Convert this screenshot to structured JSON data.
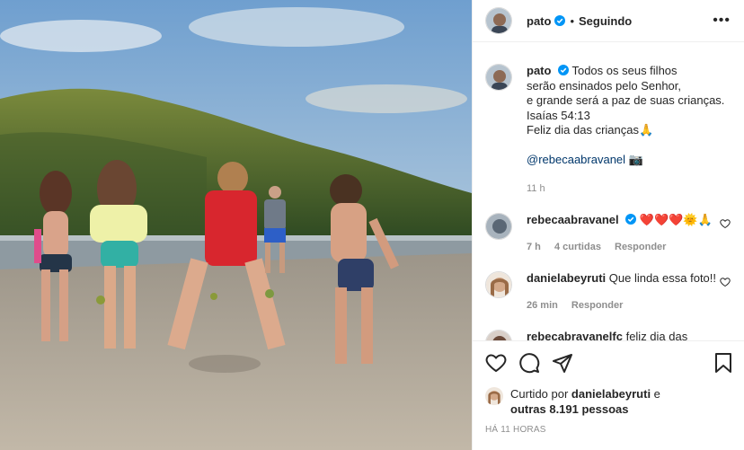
{
  "header": {
    "username": "pato",
    "separator": "•",
    "follow_label": "Seguindo",
    "more_label": "•••"
  },
  "caption": {
    "username": "pato",
    "lines": [
      "Todos os seus filhos",
      "serão ensinados pelo Senhor,",
      "e grande será a paz de suas crianças.",
      "Isaías 54:13",
      "Feliz dia das crianças🙏"
    ],
    "mention": "@rebecaabravanel 📷",
    "time": "11 h"
  },
  "comments": [
    {
      "username": "rebecaabravanel",
      "text": "❤️❤️❤️🌞🙏",
      "time": "7 h",
      "likes": "4 curtidas",
      "reply": "Responder"
    },
    {
      "username": "danielabeyruti",
      "text": "Que linda essa foto!!",
      "time": "26 min",
      "reply": "Responder"
    },
    {
      "username": "rebecabravanelfc",
      "text": "feliz dia das"
    }
  ],
  "likes": {
    "prefix": "Curtido por ",
    "user": "danielabeyruti",
    "mid": " e",
    "others": "outras 8.191 pessoas"
  },
  "posted": "HÁ 11 HORAS",
  "icons": [
    "heart-icon",
    "comment-icon",
    "share-icon",
    "bookmark-icon",
    "verified-icon",
    "more-icon"
  ],
  "colors": {
    "verified": "#0095f6",
    "link": "#00376b",
    "muted": "#8e8e8e",
    "border": "#efefef"
  }
}
